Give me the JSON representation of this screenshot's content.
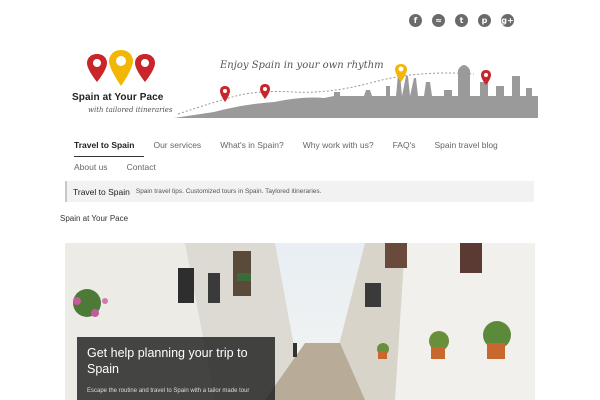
{
  "social": [
    {
      "name": "facebook",
      "glyph": "f"
    },
    {
      "name": "rss",
      "glyph": "≈"
    },
    {
      "name": "twitter",
      "glyph": "t"
    },
    {
      "name": "pinterest",
      "glyph": "p"
    },
    {
      "name": "googleplus",
      "glyph": "g+"
    }
  ],
  "logo": {
    "title": "Spain at Your Pace",
    "subtitle": "with tailored itineraries"
  },
  "banner": {
    "tagline": "Enjoy Spain in your own rhythm"
  },
  "nav": {
    "items": [
      {
        "label": "Travel to Spain",
        "active": true
      },
      {
        "label": "Our services"
      },
      {
        "label": "What's in Spain?"
      },
      {
        "label": "Why work with us?"
      },
      {
        "label": "FAQ's"
      },
      {
        "label": "Spain travel blog"
      }
    ],
    "items2": [
      {
        "label": "About us"
      },
      {
        "label": "Contact"
      }
    ]
  },
  "crumb": {
    "title": "Travel to Spain",
    "description": "Spain travel tips. Customized tours in Spain. Taylored itineraries."
  },
  "site_label": "Spain at Your Pace",
  "hero": {
    "heading": "Get help planning your trip to Spain",
    "text": "Escape the routine and travel to Spain with a tailor made tour"
  },
  "colors": {
    "pin_red": "#c9262c",
    "pin_yellow": "#f2b705",
    "skyline_gray": "#9a9a9a"
  }
}
